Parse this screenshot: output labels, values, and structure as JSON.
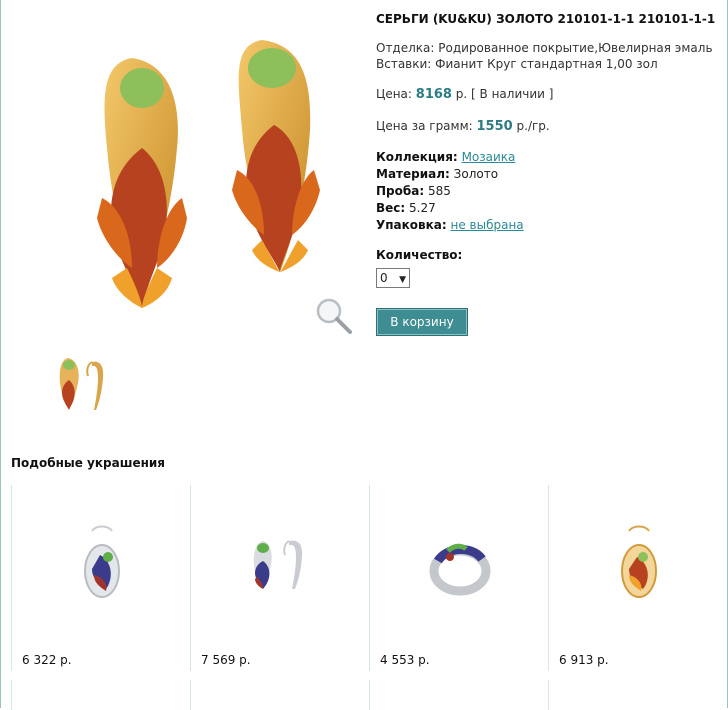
{
  "product": {
    "title": "СЕРЬГИ (KU&KU) ЗОЛОТО 210101-1-1 210101-1-1",
    "finish_label": "Отделка:",
    "finish_value": "Родированное покрытие,Ювелирная эмаль",
    "inserts_label": "Вставки:",
    "inserts_value": "Фианит Круг стандартная 1,00 зол",
    "price_label": "Цена:",
    "price_value": "8168",
    "price_suffix": "р. [ В наличии ]",
    "per_gram_label": "Цена за грамм:",
    "per_gram_value": "1550",
    "per_gram_suffix": "р./гр.",
    "collection_label": "Коллекция:",
    "collection_value": "Мозаика",
    "material_label": "Материал:",
    "material_value": "Золото",
    "assay_label": "Проба:",
    "assay_value": "585",
    "weight_label": "Вес:",
    "weight_value": "5.27",
    "packaging_label": "Упаковка:",
    "packaging_value": "не выбрана",
    "quantity_label": "Количество:",
    "quantity_value": "0",
    "cart_button": "В корзину"
  },
  "similar": {
    "title": "Подобные украшения",
    "items": [
      {
        "price": "6 322 р.",
        "icon": "silver-pendant-icon"
      },
      {
        "price": "7 569 р.",
        "icon": "silver-earrings-icon"
      },
      {
        "price": "4 553 р.",
        "icon": "silver-ring-icon"
      },
      {
        "price": "6 913 р.",
        "icon": "gold-pendant-icon"
      }
    ]
  },
  "colors": {
    "accent": "#2c7c86",
    "button": "#3e8d93",
    "link": "#2a8a96"
  }
}
